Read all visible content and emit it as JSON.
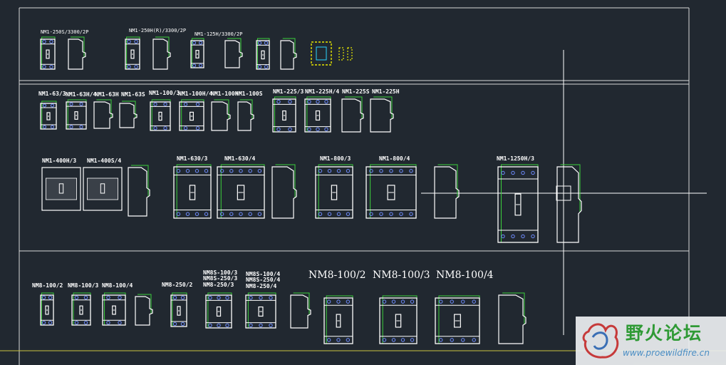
{
  "labels": {
    "r1": [
      "NM1-250S/3300/2P",
      "NM1-250H(R)/3300/2P",
      "NM1-125H/3300/2P"
    ],
    "r2": [
      "NM1-63/3",
      "NM1-63H/4",
      "NM1-63H",
      "NM1-63S",
      "NM1-100/3",
      "NM1-100H/4",
      "NM1-100H",
      "NM1-100S",
      "NM1-225/3",
      "NM1-225H/4",
      "NM1-225S",
      "NM1-225H"
    ],
    "r3": [
      "NM1-400H/3",
      "NM1-400S/4",
      "NM1-630/3",
      "NM1-630/4",
      "NM1-800/3",
      "NM1-800/4",
      "NM1-1250H/3"
    ],
    "r4": [
      "NM8-100/2",
      "NM8-100/3",
      "NM8-100/4",
      "NM8-250/2",
      "NM8S-100/3",
      "NM8S-250/3",
      "NM8-250/3",
      "NM8S-100/4",
      "NM8S-250/4",
      "NM8-250/4"
    ],
    "r4big": [
      "NM8-100/2",
      "NM8-100/3",
      "NM8-100/4"
    ]
  },
  "watermark": {
    "title": "野火论坛",
    "url": "www.proewildfire.cn"
  }
}
